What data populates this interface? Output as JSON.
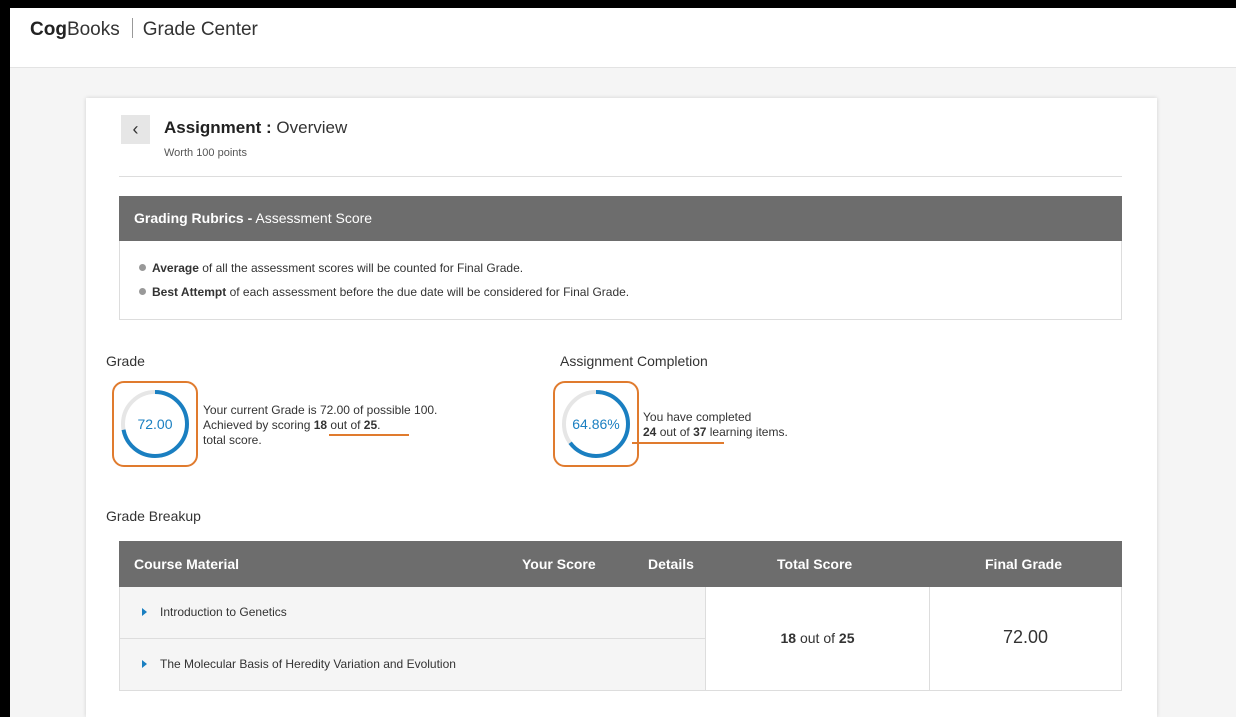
{
  "header": {
    "brand_bold": "Cog",
    "brand_rest": "Books",
    "section": "Grade Center"
  },
  "assignment": {
    "title_bold": "Assignment :",
    "title_rest": " Overview",
    "subtitle": "Worth 100 points",
    "back_glyph": "‹"
  },
  "rubric": {
    "head_bold": "Grading Rubrics -",
    "head_rest": " Assessment Score",
    "items": [
      {
        "bold": "Average",
        "rest": " of all the assessment scores will be counted for Final Grade."
      },
      {
        "bold": "Best Attempt",
        "rest": " of each assessment before the due date will be considered for Final Grade."
      }
    ]
  },
  "grade": {
    "label": "Grade",
    "value": "72.00",
    "fraction": 0.72,
    "line1": "Your current Grade is 72.00 of possible 100.",
    "line2_pre": "Achieved by scoring ",
    "score": "18",
    "out_of": " out of ",
    "total": "25",
    "period": ".",
    "line3": "total score."
  },
  "completion": {
    "label": "Assignment Completion",
    "value": "64.86%",
    "fraction": 0.6486,
    "line1": "You have completed",
    "done": "24",
    "out_of": " out of ",
    "total": "37",
    "rest": " learning items."
  },
  "breakup": {
    "label": "Grade Breakup",
    "columns": {
      "course_material": "Course Material",
      "your_score": "Your Score",
      "details": "Details",
      "total_score": "Total Score",
      "final_grade": "Final Grade"
    },
    "rows": [
      {
        "name": "Introduction to Genetics"
      },
      {
        "name": "The Molecular Basis of Heredity Variation and Evolution"
      }
    ],
    "total_score": {
      "score": "18",
      "out_of": " out of ",
      "total": "25"
    },
    "final_grade": "72.00"
  },
  "colors": {
    "accent_blue": "#1a7fc1",
    "highlight_orange": "#e07b2e",
    "header_gray": "#6d6d6d"
  }
}
